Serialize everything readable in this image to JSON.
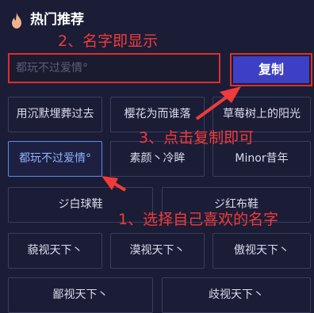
{
  "header": {
    "title": "热门推荐",
    "icon": "flame-icon"
  },
  "annotations": {
    "step1": "1、选择自己喜欢的名字",
    "step2": "2、名字即显示",
    "step3": "3、点击复制即可",
    "color": "#f23a3a"
  },
  "input": {
    "value": "都玩不过爱情°"
  },
  "copy_button": {
    "label": "复制"
  },
  "names": [
    "用沉默埋葬过去",
    "樱花为而谁落",
    "草莓树上的阳光",
    "都玩不过爱情°",
    "素颜丶冷眸",
    "Minor昔年",
    "ジ白球鞋",
    "ジ红布鞋",
    "藐视天下丶",
    "漠视天下丶",
    "傲视天下丶",
    "鄙视天下丶",
    "歧视天下丶"
  ],
  "selected_index": 3,
  "colors": {
    "background": "#1b1d36",
    "accent": "#3d3fc4",
    "selected_border": "#5d8bf0"
  }
}
